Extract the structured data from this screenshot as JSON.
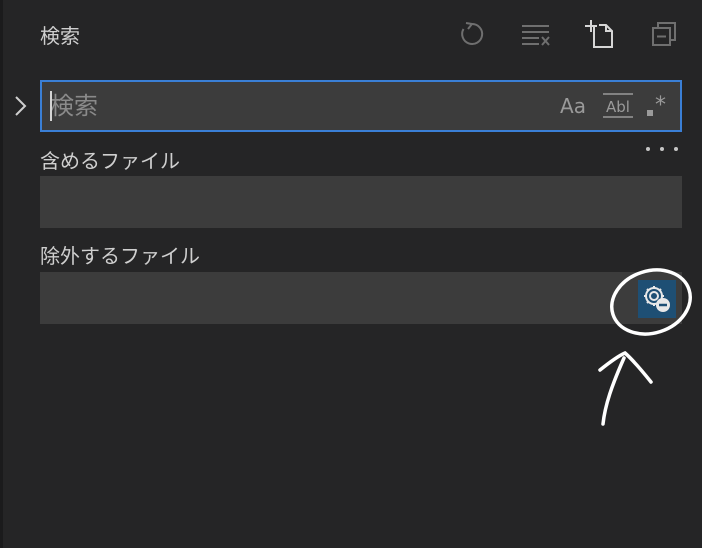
{
  "panel": {
    "title": "検索"
  },
  "header_actions": [
    {
      "name": "refresh-icon"
    },
    {
      "name": "clear-results-icon"
    },
    {
      "name": "new-search-editor-icon"
    },
    {
      "name": "collapse-all-icon"
    }
  ],
  "search": {
    "placeholder": "検索",
    "value": "",
    "match_case_label": "Aa",
    "whole_word_label": "Abl",
    "regex_label": ".*"
  },
  "include": {
    "label": "含めるファイル",
    "value": ""
  },
  "exclude": {
    "label": "除外するファイル",
    "value": ""
  },
  "colors": {
    "background": "#252526",
    "input_background": "#3c3c3c",
    "focus_border": "#3a7fd6",
    "active_toggle": "#1e4f74",
    "annotation": "#ffffff"
  }
}
